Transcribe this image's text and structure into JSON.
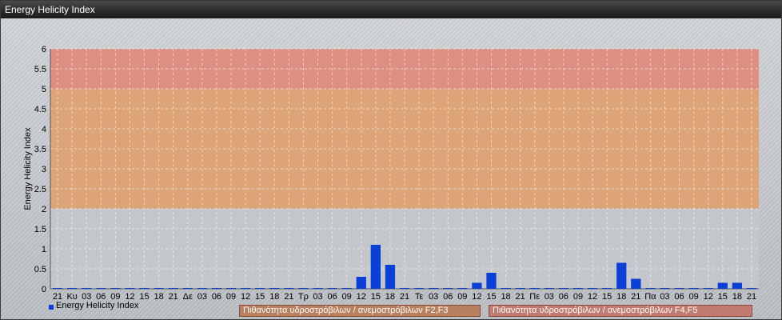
{
  "window": {
    "title": "Energy Helicity Index"
  },
  "chart_data": {
    "type": "bar",
    "ylabel": "Energy Helicity Index",
    "ylim": [
      0,
      6
    ],
    "yticks": [
      "0",
      "0.5",
      "1",
      "1.5",
      "2",
      "2.5",
      "3",
      "3.5",
      "4",
      "4.5",
      "5",
      "5.5",
      "6"
    ],
    "categories": [
      "21",
      "Κυ",
      "03",
      "06",
      "09",
      "12",
      "15",
      "18",
      "21",
      "Δε",
      "03",
      "06",
      "09",
      "12",
      "15",
      "18",
      "21",
      "Τρ",
      "03",
      "06",
      "09",
      "12",
      "15",
      "18",
      "21",
      "Τε",
      "03",
      "06",
      "09",
      "12",
      "15",
      "18",
      "21",
      "Πε",
      "03",
      "06",
      "09",
      "12",
      "15",
      "18",
      "21",
      "Πα",
      "03",
      "06",
      "09",
      "12",
      "15",
      "18",
      "21"
    ],
    "series": [
      {
        "name": "Energy Helicity Index",
        "color": "#0a3fd8",
        "values": [
          0.02,
          0.02,
          0.02,
          0.02,
          0.02,
          0.02,
          0.02,
          0.02,
          0.02,
          0.02,
          0.02,
          0.02,
          0.02,
          0.02,
          0.02,
          0.02,
          0.02,
          0.02,
          0.02,
          0.02,
          0.02,
          0.3,
          1.1,
          0.6,
          0.02,
          0.02,
          0.02,
          0.02,
          0.02,
          0.15,
          0.4,
          0.02,
          0.02,
          0.02,
          0.02,
          0.02,
          0.02,
          0.02,
          0.02,
          0.65,
          0.25,
          0.02,
          0.02,
          0.02,
          0.02,
          0.02,
          0.15,
          0.15,
          0.02
        ]
      }
    ],
    "bands": [
      {
        "from": 5,
        "to": 6,
        "color": "#e0887a",
        "label": "Πιθανότητα υδροστρόβιλων / ανεμοστρόβιλων F4,F5"
      },
      {
        "from": 2,
        "to": 5,
        "color": "#e0a06e",
        "label": "Πιθανότητα υδροστρόβιλων / ανεμοστρόβιλων F2,F3"
      }
    ],
    "grid": true,
    "legend_position": "bottom-left"
  },
  "legend": {
    "series_label": "Energy Helicity Index",
    "band_f23": "Πιθανότητα υδροστρόβιλων / ανεμοστρόβιλων F2,F3",
    "band_f45": "Πιθανότητα υδροστρόβιλων / ανεμοστρόβιλων F4,F5"
  }
}
